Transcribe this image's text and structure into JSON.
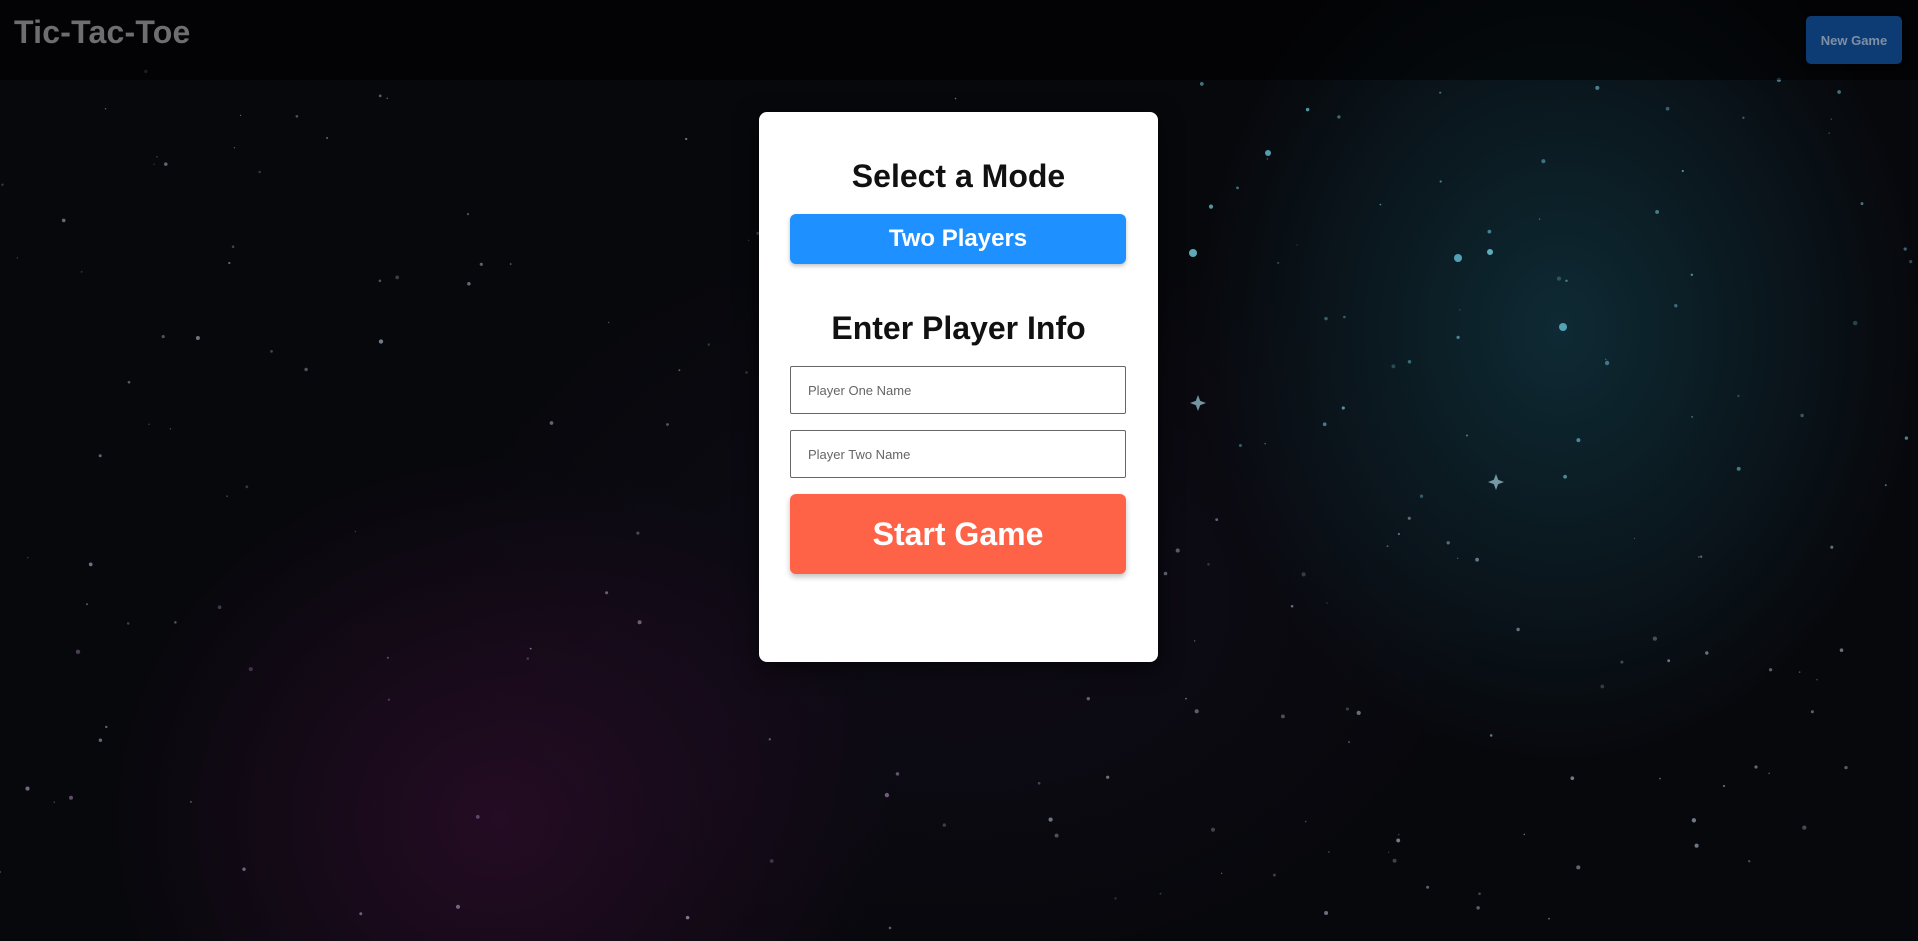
{
  "header": {
    "title": "Tic-Tac-Toe",
    "new_game_label": "New Game"
  },
  "setup": {
    "mode_heading": "Select a Mode",
    "mode_button_label": "Two Players",
    "player_heading": "Enter Player Info",
    "player_one_placeholder": "Player One Name",
    "player_two_placeholder": "Player Two Name",
    "start_label": "Start Game"
  },
  "colors": {
    "mode_button": "#1e90ff",
    "start_button": "#ff6347",
    "new_game_button": "#0d3c75",
    "background": "#07080c"
  }
}
